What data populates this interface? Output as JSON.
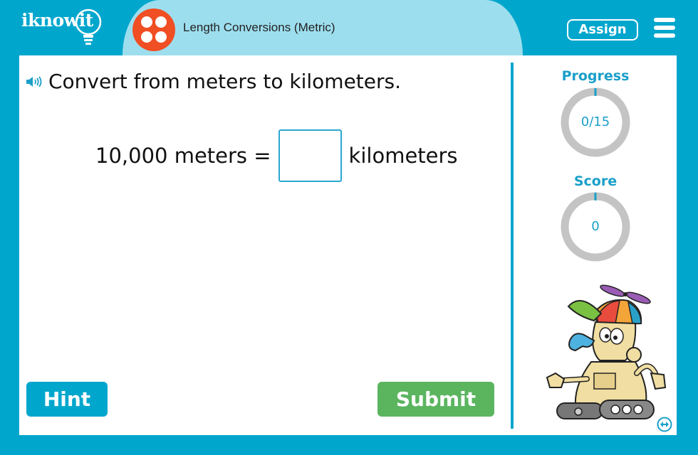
{
  "header": {
    "logo_text": "iknowit",
    "topic_title": "Length Conversions (Metric)",
    "assign_label": "Assign",
    "menu_icon": "hamburger-menu-icon",
    "topic_icon": "four-dots-icon"
  },
  "question": {
    "prompt": "Convert from meters to kilometers.",
    "speaker_icon": "speaker-icon",
    "left_side": "10,000 meters =",
    "answer_value": "",
    "unit": "kilometers"
  },
  "buttons": {
    "hint": "Hint",
    "submit": "Submit"
  },
  "sidebar": {
    "progress_label": "Progress",
    "progress_value": "0/15",
    "progress_fraction": 0,
    "score_label": "Score",
    "score_value": "0",
    "mascot": "robot-mascot-with-propeller-cap",
    "swap_icon": "swap-layout-icon"
  },
  "colors": {
    "frame": "#01a6cd",
    "header_pill": "#9ddeee",
    "topic_icon": "#f04e23",
    "submit": "#5bb55f",
    "ring_track": "#c4c4c4",
    "accent_text": "#1a9fc9"
  }
}
